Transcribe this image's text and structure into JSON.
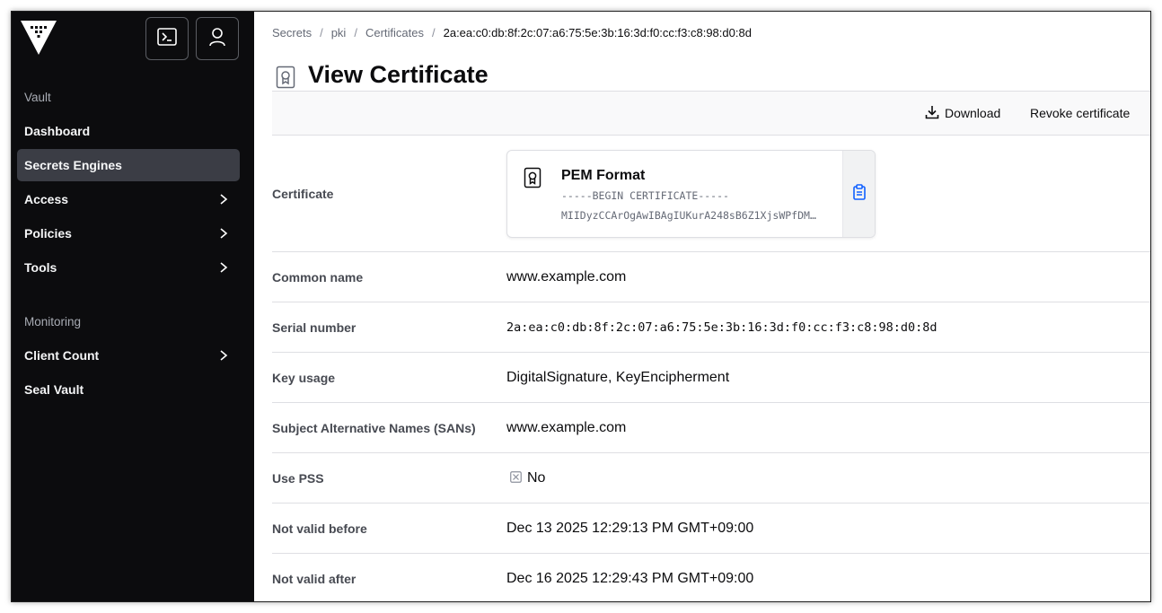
{
  "sidebar": {
    "section_vault": "Vault",
    "section_monitoring": "Monitoring",
    "items": [
      {
        "label": "Dashboard"
      },
      {
        "label": "Secrets Engines"
      },
      {
        "label": "Access"
      },
      {
        "label": "Policies"
      },
      {
        "label": "Tools"
      },
      {
        "label": "Client Count"
      },
      {
        "label": "Seal Vault"
      }
    ],
    "active_item": "Secrets Engines"
  },
  "breadcrumb": {
    "items": [
      "Secrets",
      "pki",
      "Certificates"
    ],
    "current": "2a:ea:c0:db:8f:2c:07:a6:75:5e:3b:16:3d:f0:cc:f3:c8:98:d0:8d",
    "separator": "/"
  },
  "page": {
    "title": "View Certificate"
  },
  "toolbar": {
    "download_label": "Download",
    "revoke_label": "Revoke certificate"
  },
  "certificate": {
    "label": "Certificate",
    "pem_title": "PEM Format",
    "pem_line1": "-----BEGIN CERTIFICATE-----",
    "pem_line2": "MIIDyzCCArOgAwIBAgIUKurA248sB6Z1XjsWPfDM…"
  },
  "fields": [
    {
      "label": "Common name",
      "value": "www.example.com"
    },
    {
      "label": "Serial number",
      "value": "2a:ea:c0:db:8f:2c:07:a6:75:5e:3b:16:3d:f0:cc:f3:c8:98:d0:8d"
    },
    {
      "label": "Key usage",
      "value": "DigitalSignature, KeyEncipherment"
    },
    {
      "label": "Subject Alternative Names (SANs)",
      "value": "www.example.com"
    },
    {
      "label": "Use PSS",
      "value": "No"
    },
    {
      "label": "Not valid before",
      "value": "Dec 13 2025 12:29:13 PM GMT+09:00"
    },
    {
      "label": "Not valid after",
      "value": "Dec 16 2025 12:29:43 PM GMT+09:00"
    }
  ],
  "colors": {
    "sidebar_bg": "#0c0c0e",
    "active_item_bg": "#3b3d45",
    "accent_blue": "#1060ff",
    "border": "#dedfe3"
  },
  "icons": [
    "vault-logo-icon",
    "terminal-icon",
    "user-icon",
    "chevron-right-icon",
    "certificate-icon",
    "download-icon",
    "clipboard-copy-icon",
    "x-square-icon"
  ]
}
